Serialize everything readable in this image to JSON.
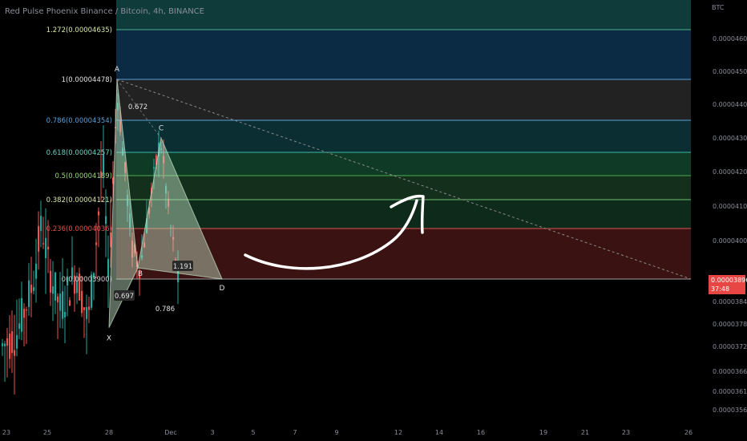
{
  "header": {
    "title": "Red Pulse Phoenix Binance / Bitcoin, 4h, BINANCE",
    "unit": "BTC"
  },
  "price_tag": {
    "price": "0.00003896",
    "countdown": "37:48"
  },
  "chart_data": {
    "type": "candlestick",
    "x_axis": {
      "tick_labels": [
        "23",
        "25",
        "28",
        "Dec",
        "3",
        "5",
        "7",
        "9",
        "12",
        "14",
        "16",
        "19",
        "21",
        "23",
        "26"
      ]
    },
    "y_axis": {
      "tick_labels": [
        "0.00004600",
        "0.00004500",
        "0.00004400",
        "0.00004300",
        "0.00004200",
        "0.00004100",
        "0.00004000",
        "0.00003900",
        "0.00003840",
        "0.00003780",
        "0.00003720",
        "0.00003660",
        "0.00003610",
        "0.00003560"
      ],
      "range": [
        3.535e-05,
        4.72e-05
      ]
    },
    "fibonacci_levels": [
      {
        "label": "1.272(0.00004635)",
        "ratio": 1.272,
        "price": 4.635e-05,
        "line": "#4caf8a",
        "fill": "#0f3b3a"
      },
      {
        "label": "1(0.00004478)",
        "ratio": 1,
        "price": 4.478e-05,
        "line": "#5aa0d8",
        "fill": "#0b2a44"
      },
      {
        "label": "0.786(0.00004354)",
        "ratio": 0.786,
        "price": 4.354e-05,
        "line": "#5aa0d8",
        "fill": "#222222"
      },
      {
        "label": "0.618(0.00004257)",
        "ratio": 0.618,
        "price": 4.257e-05,
        "line": "#3fb6a8",
        "fill": "#0b2e33"
      },
      {
        "label": "0.5(0.00004189)",
        "ratio": 0.5,
        "price": 4.189e-05,
        "line": "#4caf50",
        "fill": "#0e3a26"
      },
      {
        "label": "0.382(0.00004121)",
        "ratio": 0.382,
        "price": 4.121e-05,
        "line": "#6fbf73",
        "fill": "#14301c"
      },
      {
        "label": "0.236(0.00004036)",
        "ratio": 0.236,
        "price": 4.036e-05,
        "line": "#e0524b",
        "fill": "#0e2a1b"
      },
      {
        "label": "0(0.00003900)",
        "ratio": 0,
        "price": 3.9e-05,
        "line": "#9e9e9e",
        "fill": "#3a1212"
      }
    ],
    "harmonic_pattern": {
      "points": [
        {
          "name": "X",
          "price": 3.77e-05
        },
        {
          "name": "A",
          "price": 4.478e-05
        },
        {
          "name": "B",
          "price": 3.93e-05
        },
        {
          "name": "C",
          "price": 4.3e-05
        },
        {
          "name": "D",
          "price": 3.9e-05
        }
      ],
      "ratio_labels": [
        "0.672",
        "0.697",
        "0.786",
        "1.191"
      ]
    },
    "last_price": 3.896e-05
  }
}
